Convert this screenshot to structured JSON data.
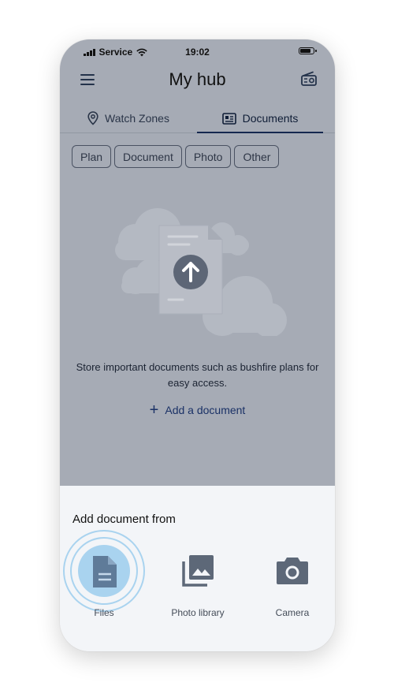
{
  "status_bar": {
    "carrier": "Service",
    "time": "19:02"
  },
  "header": {
    "title": "My hub",
    "menu_icon": "menu-icon",
    "radio_icon": "radio-icon"
  },
  "tabs": [
    {
      "label": "Watch Zones",
      "icon": "location-pin-icon",
      "active": false
    },
    {
      "label": "Documents",
      "icon": "document-card-icon",
      "active": true
    }
  ],
  "filters": [
    "Plan",
    "Document",
    "Photo",
    "Other"
  ],
  "empty_state": {
    "description": "Store important documents such as bushfire plans for easy access.",
    "add_label": "Add a document"
  },
  "sheet": {
    "title": "Add document from",
    "options": [
      {
        "label": "Files",
        "icon": "file-icon",
        "highlighted": true
      },
      {
        "label": "Photo library",
        "icon": "photo-library-icon"
      },
      {
        "label": "Camera",
        "icon": "camera-icon"
      }
    ]
  },
  "colors": {
    "overlay_bg": "#a6abb5",
    "sheet_bg": "#f3f5f8",
    "accent": "#15284f",
    "highlight_ring": "#a9d3ef"
  }
}
